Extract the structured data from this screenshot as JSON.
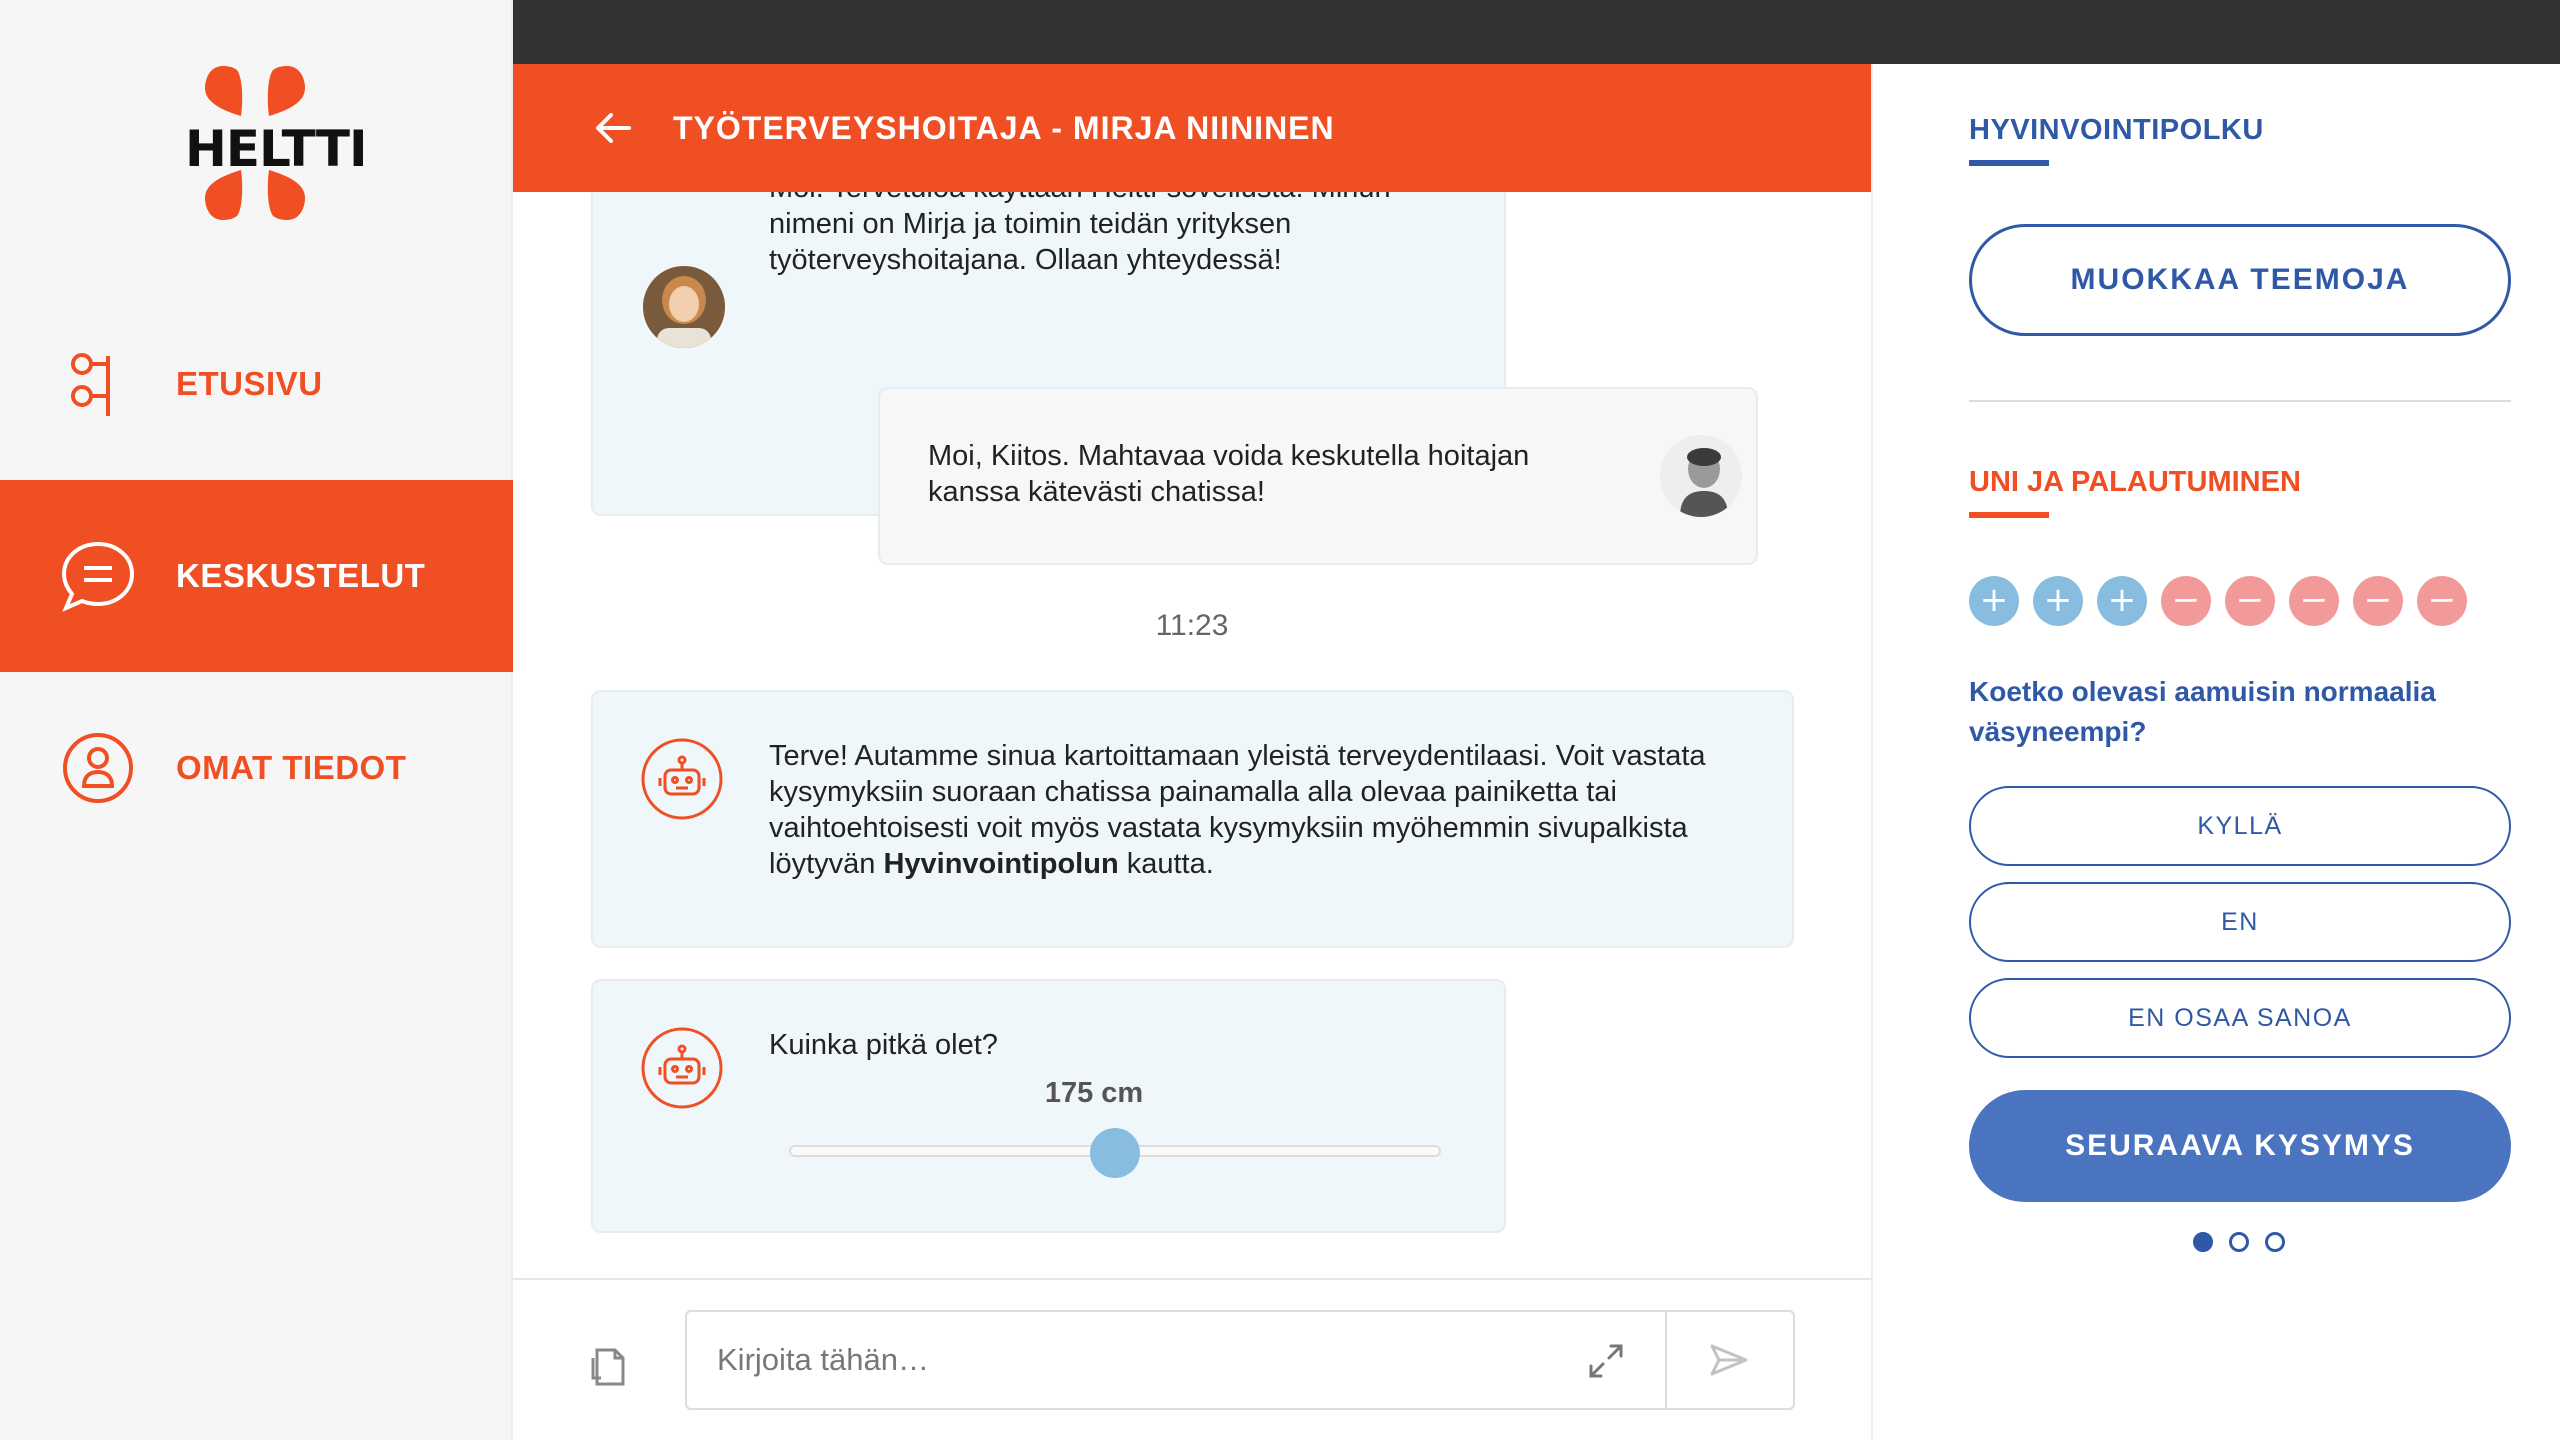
{
  "app": {
    "logo_text": "HELTTI"
  },
  "colors": {
    "brand_orange": "#f04e23",
    "brand_blue": "#2f59a6",
    "button_blue": "#4a74c0",
    "plus_dot": "#88bde0",
    "minus_dot": "#f29a9a"
  },
  "sidebar": {
    "items": [
      {
        "label": "ETUSIVU",
        "icon": "home-flow-icon",
        "active": false
      },
      {
        "label": "KESKUSTELUT",
        "icon": "chat-bubble-icon",
        "active": true
      },
      {
        "label": "OMAT TIEDOT",
        "icon": "profile-icon",
        "active": false
      }
    ]
  },
  "chat": {
    "title": "TYÖTERVEYSHOITAJA - MIRJA NIININEN",
    "messages": [
      {
        "from": "nurse",
        "line1": "Moi. Tervetuloa käyttään Heltti-sovellusta. Minun",
        "line2": "nimeni on Mirja ja toimin teidän yrityksen",
        "line3": "työterveyshoitajana. Ollaan yhteydessä!"
      },
      {
        "from": "user",
        "line1": "Moi, Kiitos. Mahtavaa voida keskutella hoitajan",
        "line2": "kanssa kätevästi chatissa!"
      },
      {
        "from": "bot",
        "line1": "Terve! Autamme sinua kartoittamaan yleistä terveydentilaasi. Voit vastata",
        "line2": "kysymyksiin suoraan chatissa painamalla alla olevaa painiketta tai",
        "line3": "vaihtoehtoisesti voit myös vastata kysymyksiin myöhemmin sivupalkista",
        "line4_pre": "löytyvän ",
        "line4_bold": "Hyvinvointipolun",
        "line4_post": " kautta."
      },
      {
        "from": "bot",
        "question": "Kuinka pitkä olet?",
        "slider_value": "175 cm",
        "slider_fraction": 0.5
      }
    ],
    "timestamp": "11:23"
  },
  "input": {
    "placeholder": "Kirjoita tähän…",
    "value": ""
  },
  "panel": {
    "title": "HYVINVOINTIPOLKU",
    "edit_button": "MUOKKAA TEEMOJA",
    "section_title": "UNI JA PALAUTUMINEN",
    "indicators": [
      "+",
      "+",
      "+",
      "−",
      "−",
      "−",
      "−",
      "−"
    ],
    "question": "Koetko olevasi aamuisin normaalia väsyneempi?",
    "answers": [
      "KYLLÄ",
      "EN",
      "EN OSAA SANOA"
    ],
    "next_button": "SEURAAVA KYSYMYS",
    "pager": {
      "total": 3,
      "current": 1
    }
  }
}
